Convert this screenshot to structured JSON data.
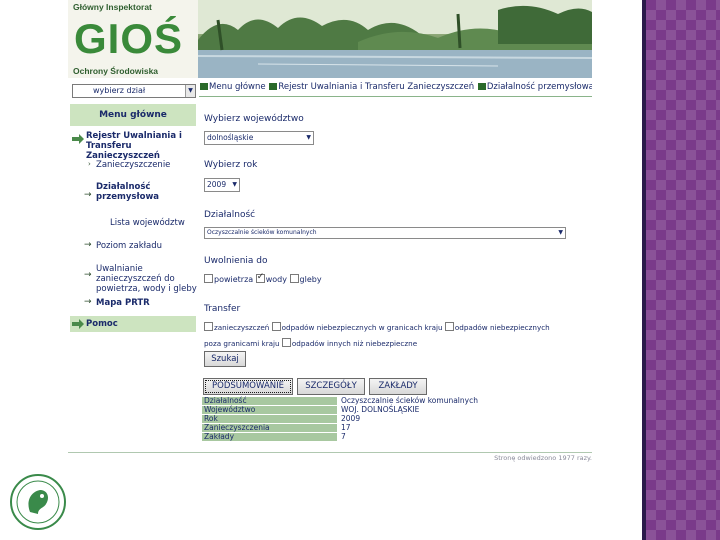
{
  "header": {
    "inspector": "Główny Inspektorat",
    "acronym": "GIOŚ",
    "protection": "Ochrony Środowiska"
  },
  "left_nav": {
    "select_value": "wybierz dział",
    "menu_title": "Menu główne",
    "items": [
      {
        "label": "Rejestr Uwalniania i Transferu Zanieczyszczeń",
        "bold": true
      },
      {
        "label": "Zanieczyszczenie"
      },
      {
        "label": "Działalność przemysłowa",
        "bold": true
      },
      {
        "label": "Lista województw"
      },
      {
        "label": "Poziom zakładu"
      },
      {
        "label": "Uwalnianie zanieczyszczeń do powietrza, wody i gleby"
      },
      {
        "label": "Mapa PRTR",
        "bold": true
      },
      {
        "label": "Pomoc",
        "bold": true
      }
    ]
  },
  "breadcrumb": [
    "Menu główne",
    "Rejestr Uwalniania i Transferu Zanieczyszczeń",
    "Działalność przemysłowa"
  ],
  "form": {
    "voivodeship_label": "Wybierz województwo",
    "voivodeship_value": "dolnośląskie",
    "year_label": "Wybierz rok",
    "year_value": "2009",
    "activity_label": "Działalność",
    "activity_value": "Oczyszczalnie ścieków komunalnych",
    "release_label": "Uwolnienia do",
    "release_options": [
      {
        "label": "powietrza",
        "checked": false
      },
      {
        "label": "wody",
        "checked": true
      },
      {
        "label": "gleby",
        "checked": false
      }
    ],
    "transfer_label": "Transfer",
    "transfer_options": [
      {
        "label": "zanieczyszczeń",
        "checked": false
      },
      {
        "label": "odpadów niebezpiecznych w granicach kraju",
        "checked": false
      },
      {
        "label": "odpadów niebezpiecznych",
        "checked": false
      },
      {
        "label": "poza granicami kraju",
        "checked": false
      },
      {
        "label": "odpadów innych niż niebezpieczne",
        "checked": false
      }
    ],
    "search_button": "Szukaj"
  },
  "tabs": {
    "summary": "PODSUMOWANIE",
    "details": "SZCZEGÓŁY",
    "plants": "ZAKŁADY"
  },
  "summary": [
    {
      "key": "Działalność",
      "value": "Oczyszczalnie ścieków komunalnych"
    },
    {
      "key": "Województwo",
      "value": "WOJ. DOLNOŚLĄSKIE"
    },
    {
      "key": "Rok",
      "value": "2009"
    },
    {
      "key": "Zanieczyszczenia",
      "value": "17"
    },
    {
      "key": "Zakłady",
      "value": "7"
    }
  ],
  "footer": "Stronę odwiedzono 1977 razy.",
  "colors": {
    "accent_green": "#cde4c0",
    "table_green": "#a8c8a0",
    "link_blue": "#1a2a6a",
    "slide_purple": "#7a3a8a"
  }
}
